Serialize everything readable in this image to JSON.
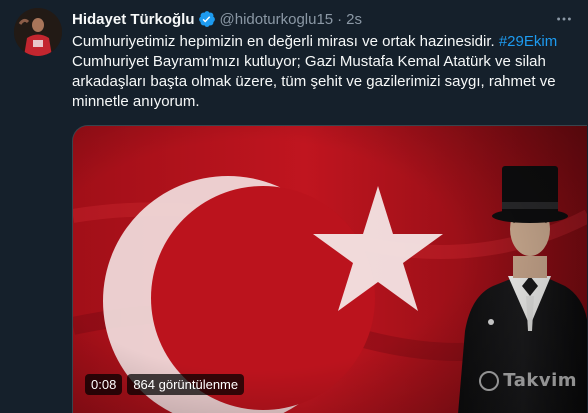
{
  "tweet": {
    "author_name": "Hidayet Türkoğlu",
    "author_handle": "@hidoturkoglu15",
    "separator": "·",
    "timestamp": "2s",
    "text_part1": "Cumhuriyetimiz hepimizin en değerli mirası ve ortak hazinesidir. ",
    "hashtag": "#29Ekim",
    "text_part2": " Cumhuriyet Bayramı'mızı kutluyor; Gazi Mustafa Kemal Atatürk ve silah arkadaşları başta olmak üzere, tüm şehit ve gazilerimizi saygı, rahmet ve minnetle anıyorum."
  },
  "media": {
    "duration": "0:08",
    "views": "864 görüntülenme",
    "watermark": "Takvim"
  },
  "colors": {
    "background": "#15202b",
    "text": "#f7f9f9",
    "muted": "#8b98a5",
    "link": "#1d9bf0",
    "verified": "#1d9bf0",
    "flag_red": "#b5121b"
  },
  "icons": {
    "verified": "verified-badge-icon",
    "more": "more-horizontal-icon",
    "watermark": "takvim-logo-icon"
  }
}
